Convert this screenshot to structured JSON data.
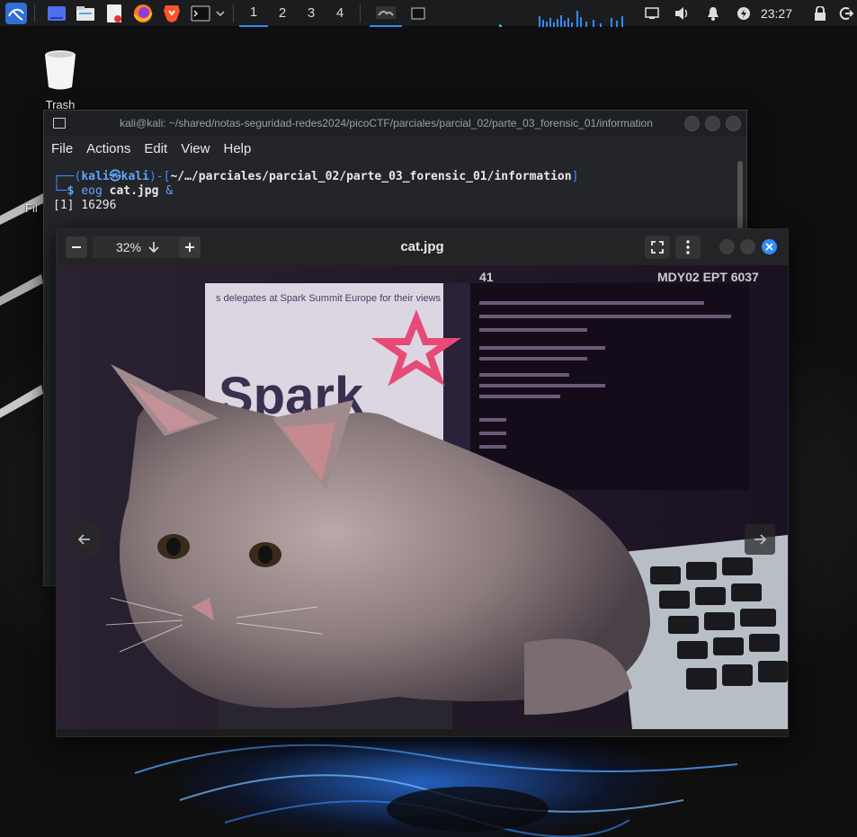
{
  "panel": {
    "workspaces": [
      "1",
      "2",
      "3",
      "4"
    ],
    "active_workspace": "1",
    "clock": "23:27",
    "icons": [
      "kali-menu-icon",
      "show-desktop-icon",
      "file-manager-icon",
      "text-editor-icon",
      "firefox-icon",
      "brave-icon",
      "terminal-icon",
      "chevron-down-icon",
      "network-icon",
      "volume-icon",
      "notifications-icon",
      "power-icon",
      "lock-icon",
      "logout-icon"
    ],
    "accent": "#2f8bff"
  },
  "desktop": {
    "trash_label": "Trash",
    "partial_label": "Fil"
  },
  "terminal": {
    "title": "kali@kali: ~/shared/notas-seguridad-redes2024/picoCTF/parciales/parcial_02/parte_03_forensic_01/information",
    "menu": [
      "File",
      "Actions",
      "Edit",
      "View",
      "Help"
    ],
    "prompt_user": "kali",
    "prompt_at": "㉿",
    "prompt_host": "kali",
    "prompt_path": "~/…/parciales/parcial_02/parte_03_forensic_01/information",
    "command_name": "eog",
    "command_arg": "cat.jpg",
    "command_bg": "&",
    "output": "[1] 16296"
  },
  "viewer": {
    "title": "cat.jpg",
    "zoom": "32%",
    "photo_text": {
      "banner": "s delegates at Spark Summit Europe for their views",
      "logo": "Spark",
      "top_left_num": "41",
      "top_right": "MDY02 EPT 6037"
    }
  }
}
